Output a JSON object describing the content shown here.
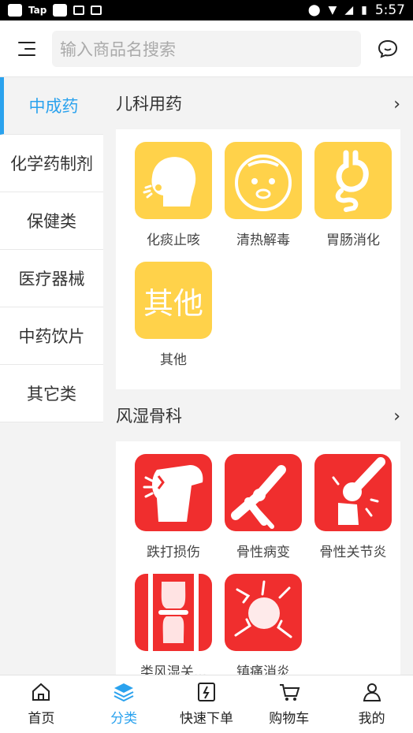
{
  "status_bar": {
    "app_label": "Tap",
    "time": "5:57"
  },
  "search": {
    "placeholder": "输入商品名搜索"
  },
  "sidebar": {
    "items": [
      {
        "label": "中成药",
        "active": true
      },
      {
        "label": "化学药制剂"
      },
      {
        "label": "保健类"
      },
      {
        "label": "医疗器械"
      },
      {
        "label": "中药饮片"
      },
      {
        "label": "其它类"
      }
    ]
  },
  "sections": [
    {
      "title": "儿科用药",
      "items": [
        {
          "label": "化痰止咳",
          "icon": "cough-face-icon",
          "color": "#ffd24a"
        },
        {
          "label": "清热解毒",
          "icon": "fever-baby-icon",
          "color": "#ffd24a"
        },
        {
          "label": "胃肠消化",
          "icon": "stomach-icon",
          "color": "#ffd24a"
        },
        {
          "label": "其他",
          "tile_text": "其他",
          "color": "#ffd24a"
        }
      ]
    },
    {
      "title": "风湿骨科",
      "items": [
        {
          "label": "跌打损伤",
          "icon": "knee-injury-icon",
          "color": "#f02e2e"
        },
        {
          "label": "骨性病变",
          "icon": "bone-icon",
          "color": "#f02e2e"
        },
        {
          "label": "骨性关节炎",
          "icon": "joint-inflammation-icon",
          "color": "#f02e2e"
        },
        {
          "label": "类风湿关...",
          "icon": "spine-joint-icon",
          "color": "#f02e2e"
        },
        {
          "label": "镇痛消炎",
          "icon": "pain-burst-icon",
          "color": "#f02e2e"
        }
      ]
    }
  ],
  "bottom_nav": [
    {
      "label": "首页",
      "icon": "home-icon"
    },
    {
      "label": "分类",
      "icon": "layers-icon",
      "active": true
    },
    {
      "label": "快速下单",
      "icon": "quick-order-icon"
    },
    {
      "label": "购物车",
      "icon": "cart-icon"
    },
    {
      "label": "我的",
      "icon": "user-icon"
    }
  ],
  "colors": {
    "accent": "#2aa2ee",
    "yellow": "#ffd24a",
    "red": "#f02e2e"
  }
}
